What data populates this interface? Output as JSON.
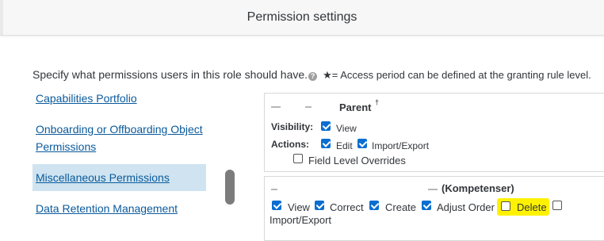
{
  "dialog": {
    "title": "Permission settings"
  },
  "intro": {
    "text": "Specify what permissions users in this role should have.",
    "star_note": "★= Access period can be defined at the granting rule level."
  },
  "nav": {
    "items": [
      {
        "label": "Capabilities Portfolio"
      },
      {
        "label": "Onboarding or Offboarding Object"
      },
      {
        "label": "Permissions"
      },
      {
        "label": "Miscellaneous Permissions",
        "selected": true
      },
      {
        "label": "Data Retention Management"
      }
    ]
  },
  "panel1": {
    "title": "Parent",
    "dagger": "†",
    "visibility_label": "Visibility:",
    "visibility_view": "View",
    "actions_label": "Actions:",
    "edit": "Edit",
    "import_export": "Import/Export",
    "field_overrides": "Field Level Overrides"
  },
  "panel2": {
    "title": "(Kompetenser)",
    "view": "View",
    "correct": "Correct",
    "create": "Create",
    "adjust_order": "Adjust Order",
    "delete": "Delete",
    "import_export": "Import/Export"
  },
  "colors": {
    "accent": "#0a6ed1",
    "link": "#0a5a9c",
    "selected_bg": "#cfe4f0",
    "highlight": "#fff200"
  }
}
